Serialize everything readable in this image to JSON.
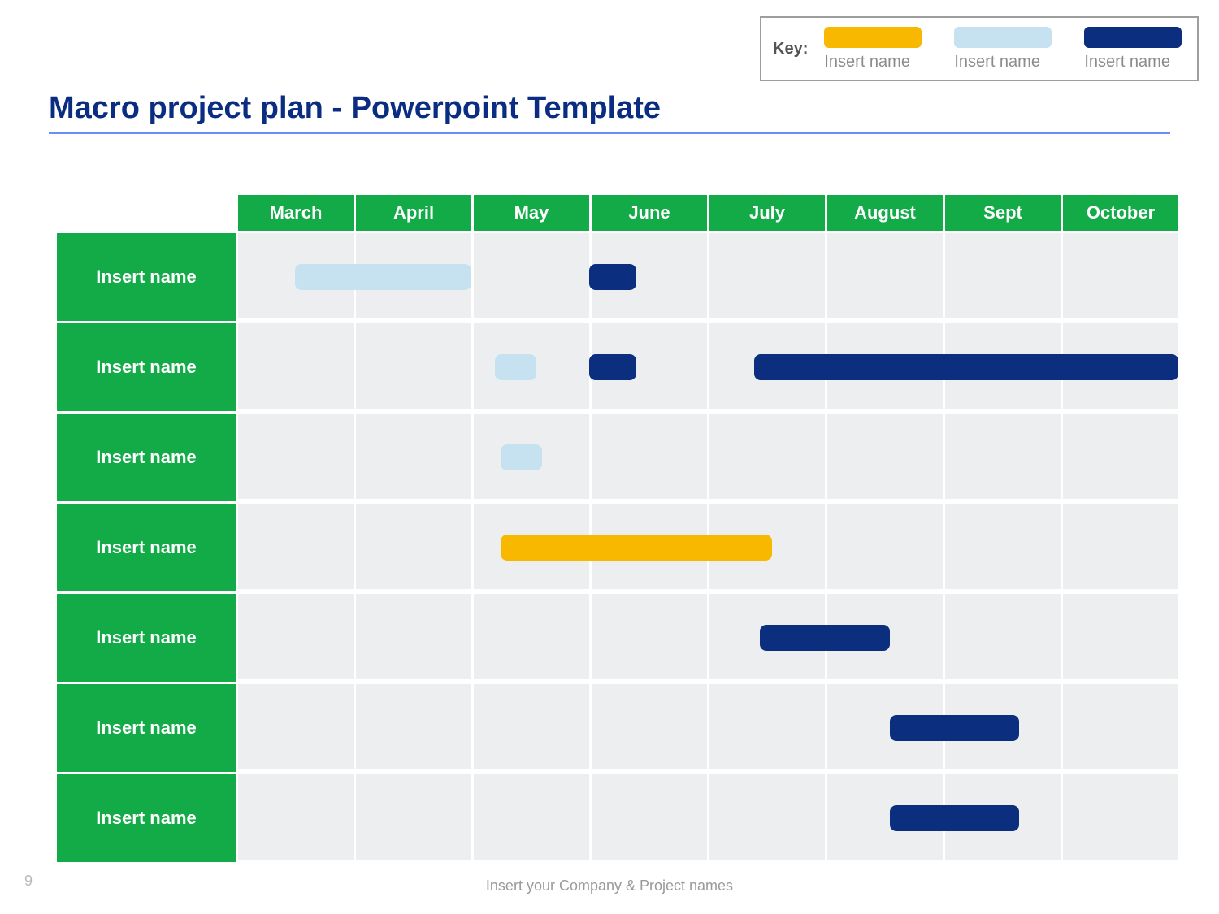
{
  "title": "Macro project plan - Powerpoint Template",
  "page_number": "9",
  "footer": "Insert your Company & Project names",
  "legend": {
    "label": "Key:",
    "items": [
      {
        "color": "#F8B800",
        "label": "Insert name"
      },
      {
        "color": "#C6E2F0",
        "label": "Insert name"
      },
      {
        "color": "#0B2E7F",
        "label": "Insert name"
      }
    ]
  },
  "columns": [
    "March",
    "April",
    "May",
    "June",
    "July",
    "August",
    "Sept",
    "October"
  ],
  "rows": [
    {
      "label": "Insert name"
    },
    {
      "label": "Insert name"
    },
    {
      "label": "Insert name"
    },
    {
      "label": "Insert name"
    },
    {
      "label": "Insert name"
    },
    {
      "label": "Insert name"
    },
    {
      "label": "Insert name"
    }
  ],
  "colors": {
    "orange": "#F8B800",
    "lightblue": "#C6E2F0",
    "navy": "#0B2E7F"
  },
  "chart_data": {
    "type": "gantt",
    "categories": [
      "March",
      "April",
      "May",
      "June",
      "July",
      "August",
      "Sept",
      "October"
    ],
    "series_colors": {
      "orange": "#F8B800",
      "lightblue": "#C6E2F0",
      "navy": "#0B2E7F"
    },
    "rows": [
      {
        "label": "Insert name",
        "bars": [
          {
            "series": "lightblue",
            "start": 0.5,
            "end": 2.0
          },
          {
            "series": "navy",
            "start": 3.0,
            "end": 3.4
          }
        ]
      },
      {
        "label": "Insert name",
        "bars": [
          {
            "series": "lightblue",
            "start": 2.2,
            "end": 2.55
          },
          {
            "series": "navy",
            "start": 3.0,
            "end": 3.4
          },
          {
            "series": "navy",
            "start": 4.4,
            "end": 8.0
          }
        ]
      },
      {
        "label": "Insert name",
        "bars": [
          {
            "series": "lightblue",
            "start": 2.25,
            "end": 2.6
          }
        ]
      },
      {
        "label": "Insert name",
        "bars": [
          {
            "series": "orange",
            "start": 2.25,
            "end": 4.55
          }
        ]
      },
      {
        "label": "Insert name",
        "bars": [
          {
            "series": "navy",
            "start": 4.45,
            "end": 5.55
          }
        ]
      },
      {
        "label": "Insert name",
        "bars": [
          {
            "series": "navy",
            "start": 5.55,
            "end": 6.65
          }
        ]
      },
      {
        "label": "Insert name",
        "bars": [
          {
            "series": "navy",
            "start": 5.55,
            "end": 6.65
          }
        ]
      }
    ]
  }
}
